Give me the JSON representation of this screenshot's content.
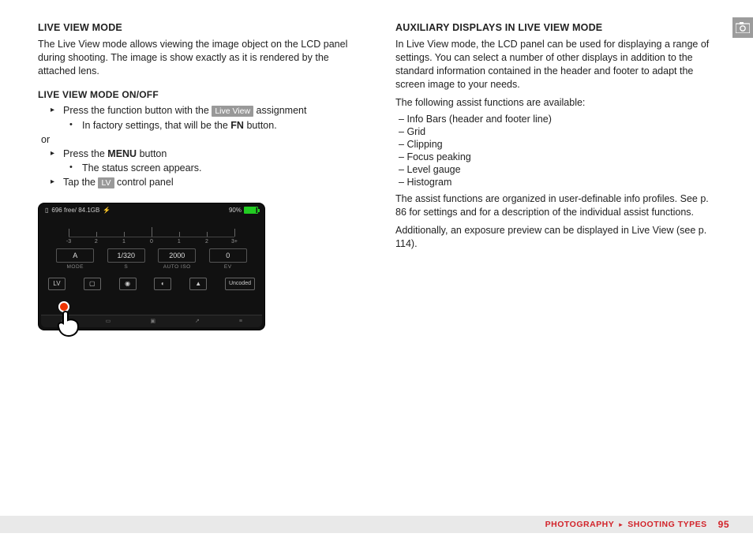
{
  "col1": {
    "h1": "LIVE VIEW MODE",
    "p1": "The Live View mode allows viewing the image object on the LCD panel during shooting. The image is show exactly as it is rendered by the attached lens.",
    "h2": "LIVE VIEW MODE ON/OFF",
    "s1_pre": "Press the function button with the ",
    "s1_pill": "Live View",
    "s1_post": " assignment",
    "s1a_pre": "In factory settings, that will be the ",
    "s1a_bold": "FN",
    "s1a_post": " button.",
    "or": "or",
    "s2_pre": "Press the ",
    "s2_bold": "MENU",
    "s2_post": " button",
    "s2a": "The status screen appears.",
    "s3_pre": "Tap the ",
    "s3_pill": "LV",
    "s3_post": " control panel"
  },
  "shot": {
    "top_left": "696 free/ 84.1GB",
    "top_pct": "90%",
    "scale_labels": [
      "-3",
      "2",
      "1",
      "0",
      "1",
      "2",
      "3+"
    ],
    "row": {
      "mode": "A",
      "s": "1/320",
      "iso": "2000",
      "ev": "0"
    },
    "row_lbl": {
      "mode": "MODE",
      "s": "S",
      "iso": "AUTO ISO",
      "ev": "EV"
    },
    "icons": {
      "lv": "LV",
      "uncoded": "Uncoded"
    }
  },
  "col2": {
    "h1": "AUXILIARY DISPLAYS IN LIVE VIEW MODE",
    "p1": "In Live View mode, the LCD panel can be used for displaying a range of settings. You can select a number of other displays in addition to the standard information contained in the header and footer to adapt the screen image to your needs.",
    "p2": "The following assist functions are available:",
    "list": {
      "i0": "Info Bars (header and footer line)",
      "i1": "Grid",
      "i2": "Clipping",
      "i3": "Focus peaking",
      "i4": "Level gauge",
      "i5": "Histogram"
    },
    "p3": "The assist functions are organized in user-definable info profiles. See p. 86 for settings and for a description of the individual assist functions.",
    "p4": "Additionally, an exposure preview can be displayed in Live View (see p. 114)."
  },
  "footer": {
    "a": "PHOTOGRAPHY",
    "b": "SHOOTING TYPES",
    "page": "95"
  }
}
